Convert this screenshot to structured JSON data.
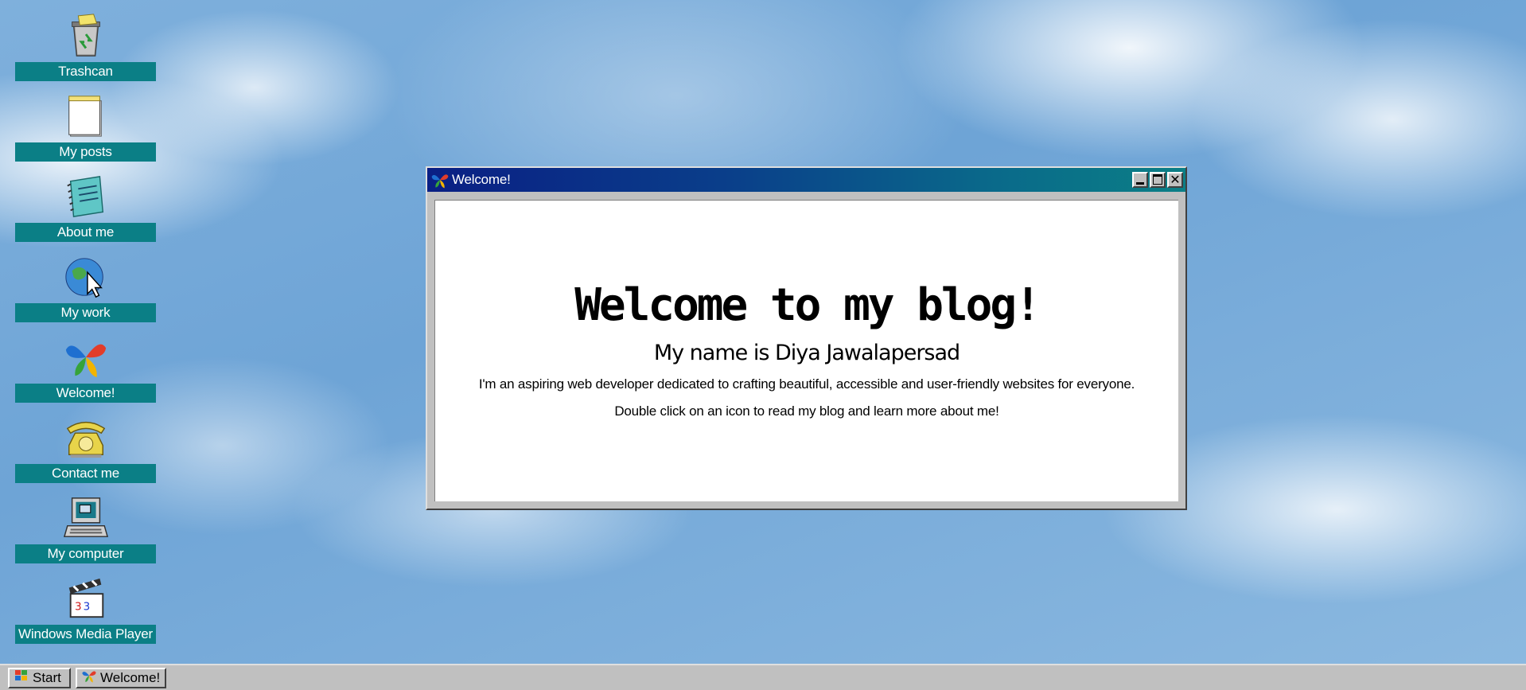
{
  "desktop": {
    "icons": [
      {
        "label": "Trashcan",
        "icon": "recycle-bin-icon"
      },
      {
        "label": "My posts",
        "icon": "notepad-icon"
      },
      {
        "label": "About me",
        "icon": "notebook-icon"
      },
      {
        "label": "My work",
        "icon": "globe-cursor-icon"
      },
      {
        "label": "Welcome!",
        "icon": "butterfly-icon"
      },
      {
        "label": "Contact me",
        "icon": "telephone-icon"
      },
      {
        "label": "My computer",
        "icon": "computer-icon"
      },
      {
        "label": "Windows Media Player",
        "icon": "clapperboard-icon"
      }
    ]
  },
  "window": {
    "title": "Welcome!",
    "heading": "Welcome to my blog!",
    "subheading": "My name is Diya Jawalapersad",
    "intro": "I'm an aspiring web developer dedicated to crafting beautiful, accessible and user-friendly websites for everyone.",
    "instructions": "Double click on an icon to read my blog and learn more about me!"
  },
  "taskbar": {
    "start_label": "Start",
    "tasks": [
      {
        "label": "Welcome!"
      }
    ]
  },
  "colors": {
    "label_bg": "#0b7f86",
    "titlebar_start": "#0a1f84",
    "titlebar_end": "#0b7f86",
    "chrome": "#c0c0c0"
  }
}
